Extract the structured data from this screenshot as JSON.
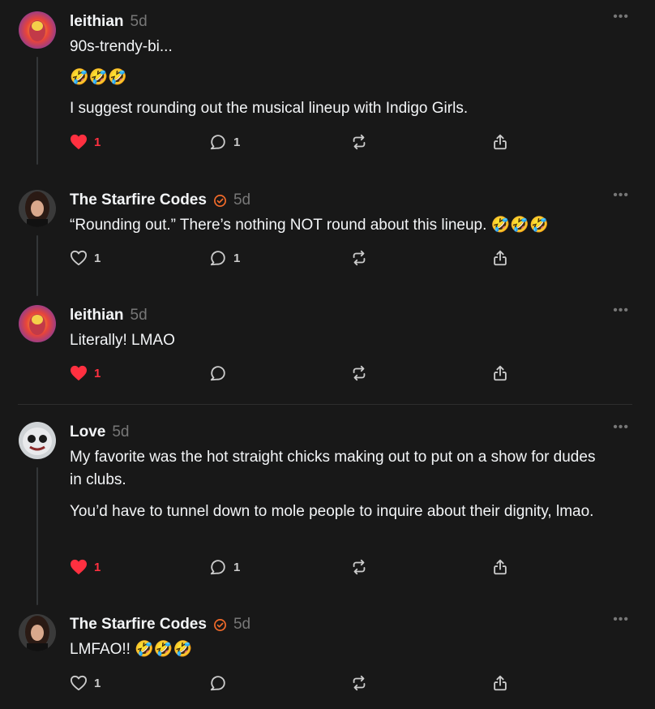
{
  "posts": [
    {
      "username": "leithian",
      "time": "5d",
      "lines": [
        "90s-trendy-bi...",
        "🤣🤣🤣",
        "I suggest rounding out the musical lineup with Indigo Girls."
      ],
      "likes": "1",
      "liked": true,
      "replies": "1"
    },
    {
      "username": "The Starfire Codes",
      "time": "5d",
      "lines": [
        "“Rounding out.” There’s nothing NOT round about this lineup. 🤣🤣🤣"
      ],
      "likes": "1",
      "liked": false,
      "replies": "1"
    },
    {
      "username": "leithian",
      "time": "5d",
      "lines": [
        "Literally! LMAO"
      ],
      "likes": "1",
      "liked": true,
      "replies": ""
    },
    {
      "username": "Love",
      "time": "5d",
      "lines": [
        "My favorite was the hot straight chicks making out to put on a show for dudes in clubs.",
        "You’d have to tunnel down to mole people to inquire about their dignity, lmao."
      ],
      "likes": "1",
      "liked": true,
      "replies": "1"
    },
    {
      "username": "The Starfire Codes",
      "time": "5d",
      "lines": [
        "LMFAO!! 🤣🤣🤣"
      ],
      "likes": "1",
      "liked": false,
      "replies": ""
    }
  ],
  "more_label": "•••",
  "colors": {
    "background": "#181818",
    "like": "#ff3040",
    "verified": "#f26b2a"
  }
}
